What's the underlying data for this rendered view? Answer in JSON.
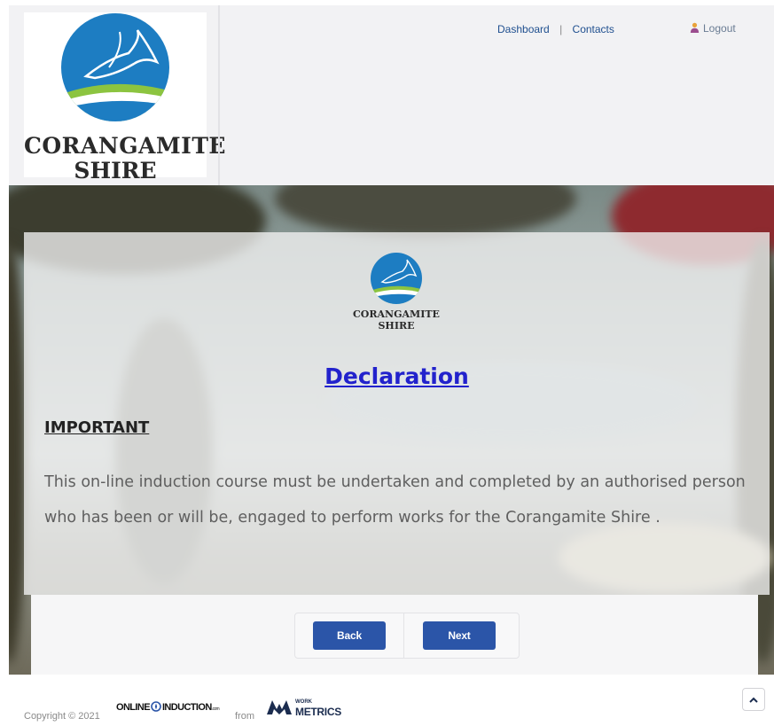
{
  "header": {
    "logo": {
      "line1": "CORANGAMITE",
      "line2": "SHIRE"
    },
    "nav": {
      "dashboard": "Dashboard",
      "separator": "|",
      "contacts": "Contacts",
      "logout": "Logout"
    }
  },
  "card": {
    "logo": {
      "line1": "CORANGAMITE",
      "line2": "SHIRE"
    },
    "title": "Declaration",
    "important": "IMPORTANT",
    "body": "This on-line induction course must be undertaken and completed by an authorised person who has been or will be, engaged to perform works for the Corangamite Shire ."
  },
  "buttons": {
    "back": "Back",
    "next": "Next"
  },
  "footer": {
    "copyright": "Copyright © 2021",
    "online_induction": {
      "main": "ONLINE",
      "main2": "INDUCTION",
      "suffix": ".com"
    },
    "from": "from",
    "workmetrics": {
      "small": "WORK",
      "big": "METRICS"
    }
  },
  "colors": {
    "accent_button": "#2b55a8",
    "title_link": "#2222cc",
    "nav_link": "#1f4f8f",
    "logo_circle": "#1d7dc2",
    "logo_green": "#8cc440"
  },
  "icons": {
    "logout": "user-icon",
    "scroll_top": "chevron-up-icon",
    "logo": "bird-logo-icon"
  }
}
